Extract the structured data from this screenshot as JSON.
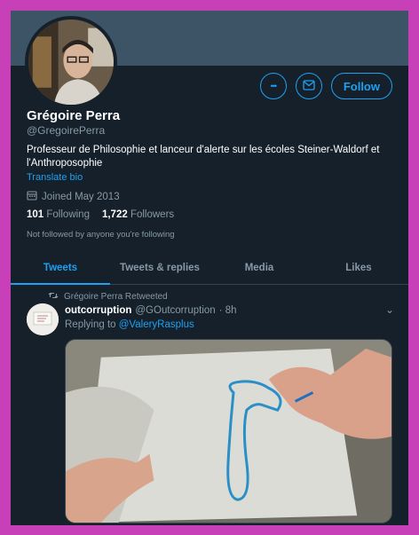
{
  "profile": {
    "name": "Grégoire Perra",
    "handle": "@GregoirePerra",
    "bio": "Professeur de Philosophie et lanceur d'alerte sur les écoles Steiner-Waldorf et l'Anthroposophie",
    "translate_label": "Translate bio",
    "joined": "Joined May 2013",
    "following_count": "101",
    "following_label": "Following",
    "followers_count": "1,722",
    "followers_label": "Followers",
    "not_followed": "Not followed by anyone you're following",
    "follow_label": "Follow",
    "more_glyph": "•••",
    "message_glyph": "✉"
  },
  "tabs": [
    {
      "label": "Tweets",
      "active": true
    },
    {
      "label": "Tweets & replies",
      "active": false
    },
    {
      "label": "Media",
      "active": false
    },
    {
      "label": "Likes",
      "active": false
    }
  ],
  "tweet": {
    "retweet_note": "Grégoire Perra Retweeted",
    "author": "outcorruption",
    "author_handle": "@GOutcorruption",
    "time": "· 8h",
    "replying_prefix": "Replying to",
    "replying_to": "@ValeryRasplus",
    "chevron_glyph": "⌄"
  },
  "colors": {
    "background": "#15202b",
    "accent": "#1da1f2",
    "muted": "#8899a6",
    "frame": "#c840b8"
  },
  "icons": [
    "more-icon",
    "message-icon",
    "calendar-icon",
    "retweet-icon",
    "chevron-down-icon"
  ]
}
